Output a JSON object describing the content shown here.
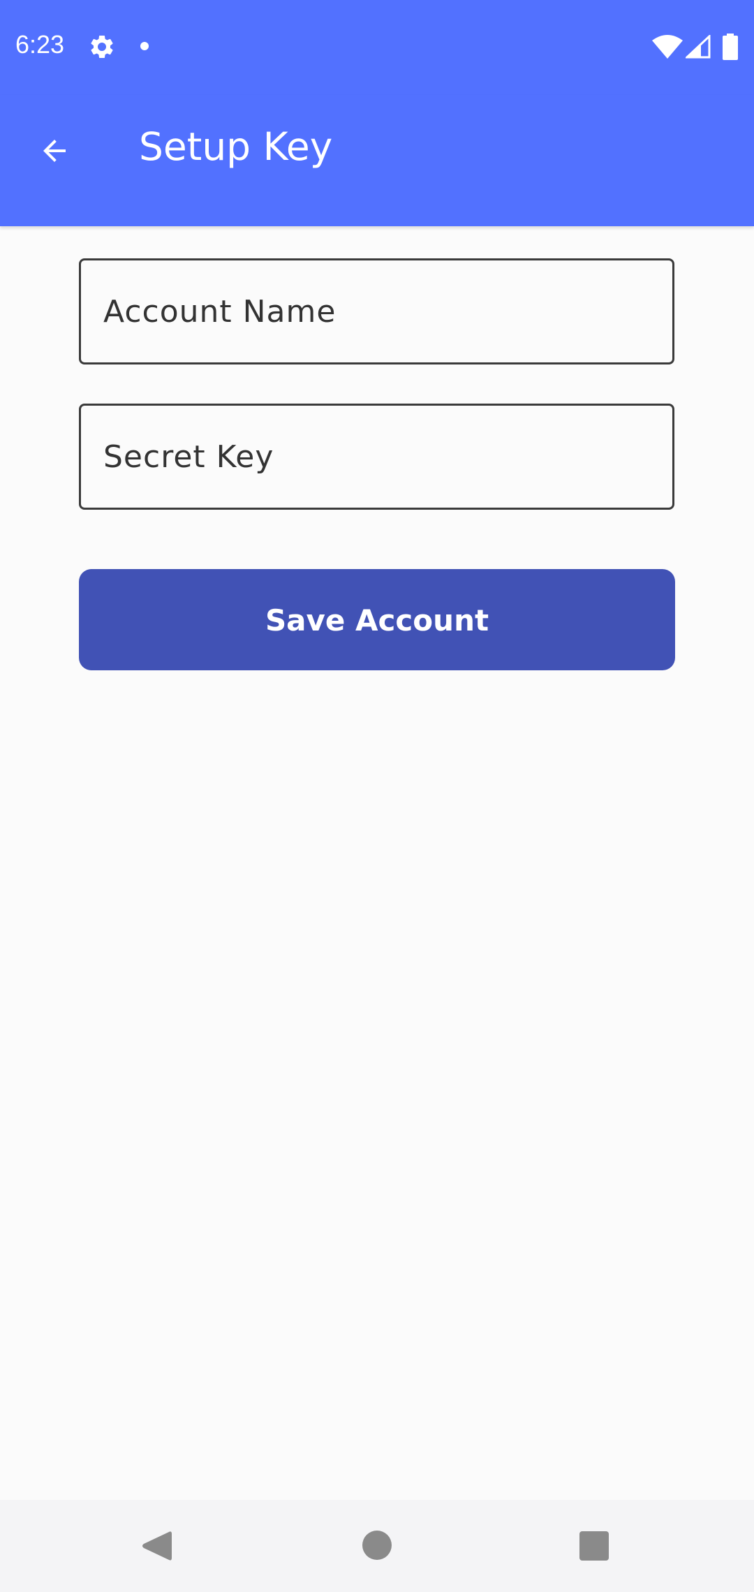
{
  "status_bar": {
    "time": "6:23",
    "icons": [
      "gear-icon",
      "dot-icon",
      "wifi-icon",
      "signal-icon",
      "battery-icon"
    ]
  },
  "app_bar": {
    "title": "Setup Key",
    "back_icon": "arrow-back-icon",
    "background": "#5271ff"
  },
  "form": {
    "account_name": {
      "placeholder": "Account Name",
      "value": ""
    },
    "secret_key": {
      "placeholder": "Secret Key",
      "value": ""
    },
    "save_label": "Save Account",
    "button_color": "#4152b5"
  },
  "nav_bar": {
    "icons": [
      "nav-back-icon",
      "nav-home-icon",
      "nav-recents-icon"
    ]
  }
}
